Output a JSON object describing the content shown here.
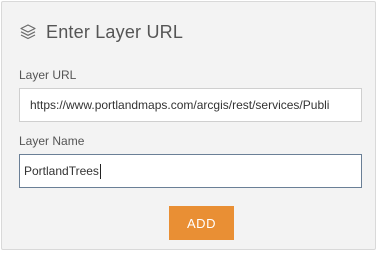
{
  "dialog": {
    "title": "Enter Layer URL",
    "icon": "layers-icon"
  },
  "form": {
    "url_label": "Layer URL",
    "url_value": "https://www.portlandmaps.com/arcgis/rest/services/Publi",
    "name_label": "Layer Name",
    "name_value": "PortlandTrees"
  },
  "actions": {
    "add_label": "ADD"
  },
  "colors": {
    "panel_background": "#f3f3f3",
    "accent_button": "#e98f34",
    "focused_border": "#6a7f96"
  }
}
